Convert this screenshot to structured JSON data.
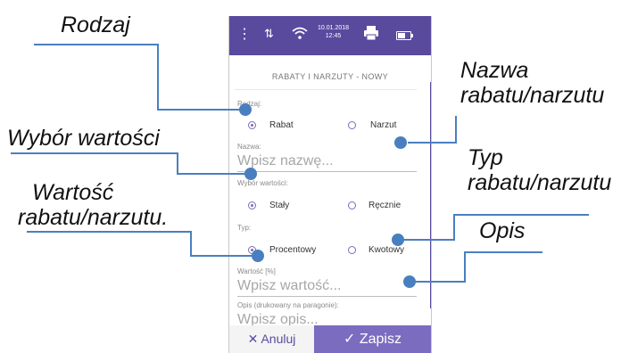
{
  "annotations": {
    "rodzaj": "Rodzaj",
    "nazwa_line1": "Nazwa",
    "nazwa_line2": "rabatu/narzutu",
    "wybor": "Wybór wartości",
    "typ_line1": "Typ",
    "typ_line2": "rabatu/narzutu",
    "wartosc_line1": "Wartość",
    "wartosc_line2": "rabatu/narzutu.",
    "opis": "Opis"
  },
  "status_bar": {
    "date": "10.01.2018",
    "time": "12:45",
    "icons": [
      "menu-dots-icon",
      "signal-arrows-icon",
      "wifi-icon",
      "printer-icon",
      "battery-icon"
    ]
  },
  "form": {
    "title": "RABATY I NARZUTY - NOWY",
    "rodzaj": {
      "label": "Rodzaj:",
      "options": [
        "Rabat",
        "Narzut"
      ],
      "selected": "Rabat"
    },
    "nazwa": {
      "label": "Nazwa:",
      "placeholder": "Wpisz nazwę..."
    },
    "wybor_wartosci": {
      "label": "Wybór wartości:",
      "options": [
        "Stały",
        "Ręcznie"
      ],
      "selected": "Stały"
    },
    "typ": {
      "label": "Typ:",
      "options": [
        "Procentowy",
        "Kwotowy"
      ],
      "selected": "Procentowy"
    },
    "wartosc": {
      "label": "Wartość [%]",
      "placeholder": "Wpisz wartość..."
    },
    "opis": {
      "label": "Opis (drukowany na paragonie):",
      "placeholder": "Wpisz opis..."
    }
  },
  "footer": {
    "cancel_label": "Anuluj",
    "save_label": "Zapisz"
  },
  "colors": {
    "accent": "#5a4a9e",
    "button": "#7b6cc0",
    "callout": "#4a7fbf"
  }
}
